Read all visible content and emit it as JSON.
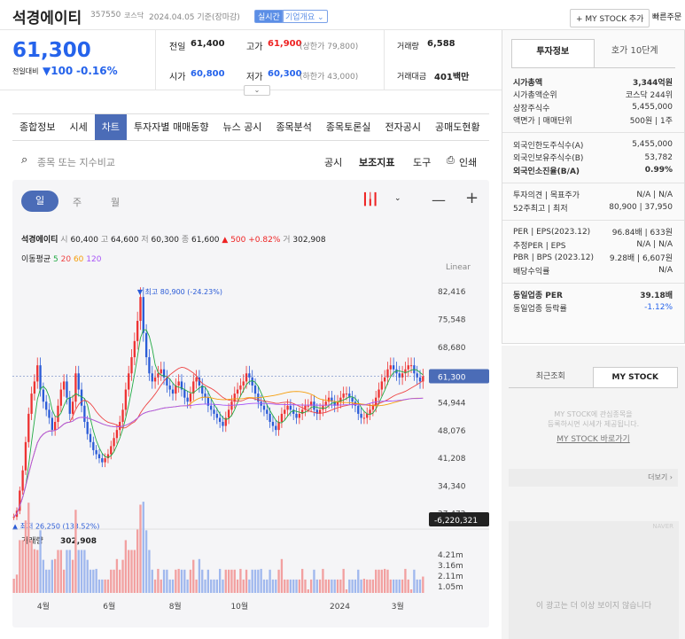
{
  "stock": {
    "name": "석경에이티",
    "code": "357550",
    "market": "코스닥",
    "date": "2024.04.05 기준(장마감)",
    "realtime": "실시간",
    "company_btn": "기업개요 ⌄"
  },
  "top_buttons": {
    "mystock": "+ MY STOCK 추가",
    "quick_order": "빠른주문"
  },
  "price": {
    "current": "61,300",
    "change_label": "전일대비",
    "change": "▼100",
    "change_pct": "-0.16%"
  },
  "quote": {
    "prev_label": "전일",
    "prev": "61,400",
    "open_label": "시가",
    "open": "60,800",
    "high_label": "고가",
    "high": "61,900",
    "upper_limit": "(상한가 79,800)",
    "low_label": "저가",
    "low": "60,300",
    "lower_limit": "(하한가 43,000)",
    "volume_label": "거래량",
    "volume": "6,588",
    "amount_label": "거래대금",
    "amount": "401백만"
  },
  "tabs": [
    "종합정보",
    "시세",
    "차트",
    "투자자별 매매동향",
    "뉴스 공시",
    "종목분석",
    "종목토론실",
    "전자공시",
    "공매도현황"
  ],
  "toolbar": {
    "search_placeholder": "종목 또는 지수비교",
    "notice": "공시",
    "indicator": "보조지표",
    "tools": "도구",
    "print": "인쇄"
  },
  "period": {
    "day": "일",
    "week": "주",
    "month": "월"
  },
  "chart_info": {
    "name": "석경에이티",
    "o_label": "시",
    "o": "60,400",
    "h_label": "고",
    "h": "64,600",
    "l_label": "저",
    "l": "60,300",
    "c_label": "종",
    "c": "61,600",
    "chg": "▲ 500",
    "chg_pct": "+0.82%",
    "v_label": "거",
    "v": "302,908"
  },
  "ma": {
    "label": "이동평균",
    "p5": "5",
    "p20": "20",
    "p60": "60",
    "p120": "120",
    "c5": "#22aa44",
    "c20": "#ee4444",
    "c60": "#f59e0b",
    "c120": "#a855f7"
  },
  "chart_data": {
    "type": "candlestick",
    "scale": "Linear",
    "y_ticks": [
      "82,416",
      "75,548",
      "68,680",
      "61,300",
      "54,944",
      "48,076",
      "41,208",
      "34,340",
      "27,472"
    ],
    "x_ticks": [
      "4월",
      "6월",
      "8월",
      "10월",
      "2024",
      "3월"
    ],
    "max_label": "▼ 최고 80,900 (-24.23%)",
    "min_label": "▲ 최저 26,250 (133.52%)",
    "current_tag": "61,300",
    "cross_tag": "-6,220,321",
    "ylim": [
      25000,
      84000
    ],
    "closes": [
      26500,
      28000,
      33000,
      38000,
      45000,
      52000,
      57000,
      60000,
      64000,
      58000,
      55000,
      53000,
      51000,
      48000,
      50000,
      54000,
      58000,
      60000,
      56000,
      52000,
      55000,
      62000,
      58000,
      54000,
      50000,
      47000,
      45000,
      43000,
      42000,
      41000,
      40000,
      41000,
      42000,
      44000,
      46000,
      48000,
      50000,
      53000,
      58000,
      62000,
      66000,
      70000,
      75000,
      80900,
      72000,
      66000,
      62000,
      60000,
      61000,
      62000,
      63000,
      61000,
      59000,
      58000,
      57000,
      59000,
      60000,
      58000,
      56000,
      55000,
      57000,
      60000,
      61000,
      59000,
      57000,
      56000,
      54000,
      53000,
      52000,
      51000,
      50000,
      49000,
      51000,
      53000,
      55000,
      57000,
      58000,
      59000,
      60000,
      62000,
      61000,
      59000,
      57000,
      55000,
      54000,
      53000,
      52000,
      50000,
      49000,
      48000,
      50000,
      52000,
      53000,
      54000,
      53000,
      52000,
      51000,
      52000,
      53000,
      54000,
      54000,
      55000,
      53000,
      52000,
      53000,
      54000,
      55000,
      56000,
      55000,
      54000,
      55000,
      56000,
      57000,
      57000,
      56000,
      55000,
      54000,
      52000,
      51000,
      51000,
      52000,
      53000,
      54000,
      56000,
      58000,
      60000,
      61000,
      63000,
      64000,
      63000,
      62000,
      61000,
      62000,
      63000,
      64000,
      64000,
      62000,
      61000,
      60000,
      61300
    ],
    "volume_label": "거래량",
    "volume": "302,908",
    "vol_ticks": [
      "4.21m",
      "3.16m",
      "2.11m",
      "1.05m"
    ]
  },
  "invest": {
    "tab1": "투자정보",
    "tab2": "호가 10단계",
    "rows1": [
      [
        "시가총액",
        "3,344억원"
      ],
      [
        "시가총액순위",
        "코스닥 244위"
      ],
      [
        "상장주식수",
        "5,455,000"
      ],
      [
        "액면가 | 매매단위",
        "500원 | 1주"
      ]
    ],
    "rows2": [
      [
        "외국인한도주식수(A)",
        "5,455,000"
      ],
      [
        "외국인보유주식수(B)",
        "53,782"
      ],
      [
        "외국인소진율(B/A)",
        "0.99%"
      ]
    ],
    "rows3": [
      [
        "투자의견 | 목표주가",
        "N/A | N/A"
      ],
      [
        "52주최고 | 최저",
        "80,900 | 37,950"
      ]
    ],
    "rows4": [
      [
        "PER | EPS(2023.12)",
        "96.84배 | 633원"
      ],
      [
        "추정PER | EPS",
        "N/A | N/A"
      ],
      [
        "PBR | BPS (2023.12)",
        "9.28배 | 6,607원"
      ],
      [
        "배당수익률",
        "N/A"
      ]
    ],
    "rows5": [
      [
        "동일업종 PER",
        "39.18배"
      ],
      [
        "동일업종 등락률",
        "-1.12%"
      ]
    ]
  },
  "recent": {
    "tab1": "최근조회",
    "tab2": "MY STOCK",
    "msg1": "MY STOCK에 관심종목을",
    "msg2": "등록하시면 시세가 제공됩니다.",
    "link": "MY STOCK 바로가기",
    "more": "더보기 ›"
  },
  "ad": {
    "label": "NAVER",
    "msg": "이 광고는 더 이상 보이지 않습니다"
  }
}
